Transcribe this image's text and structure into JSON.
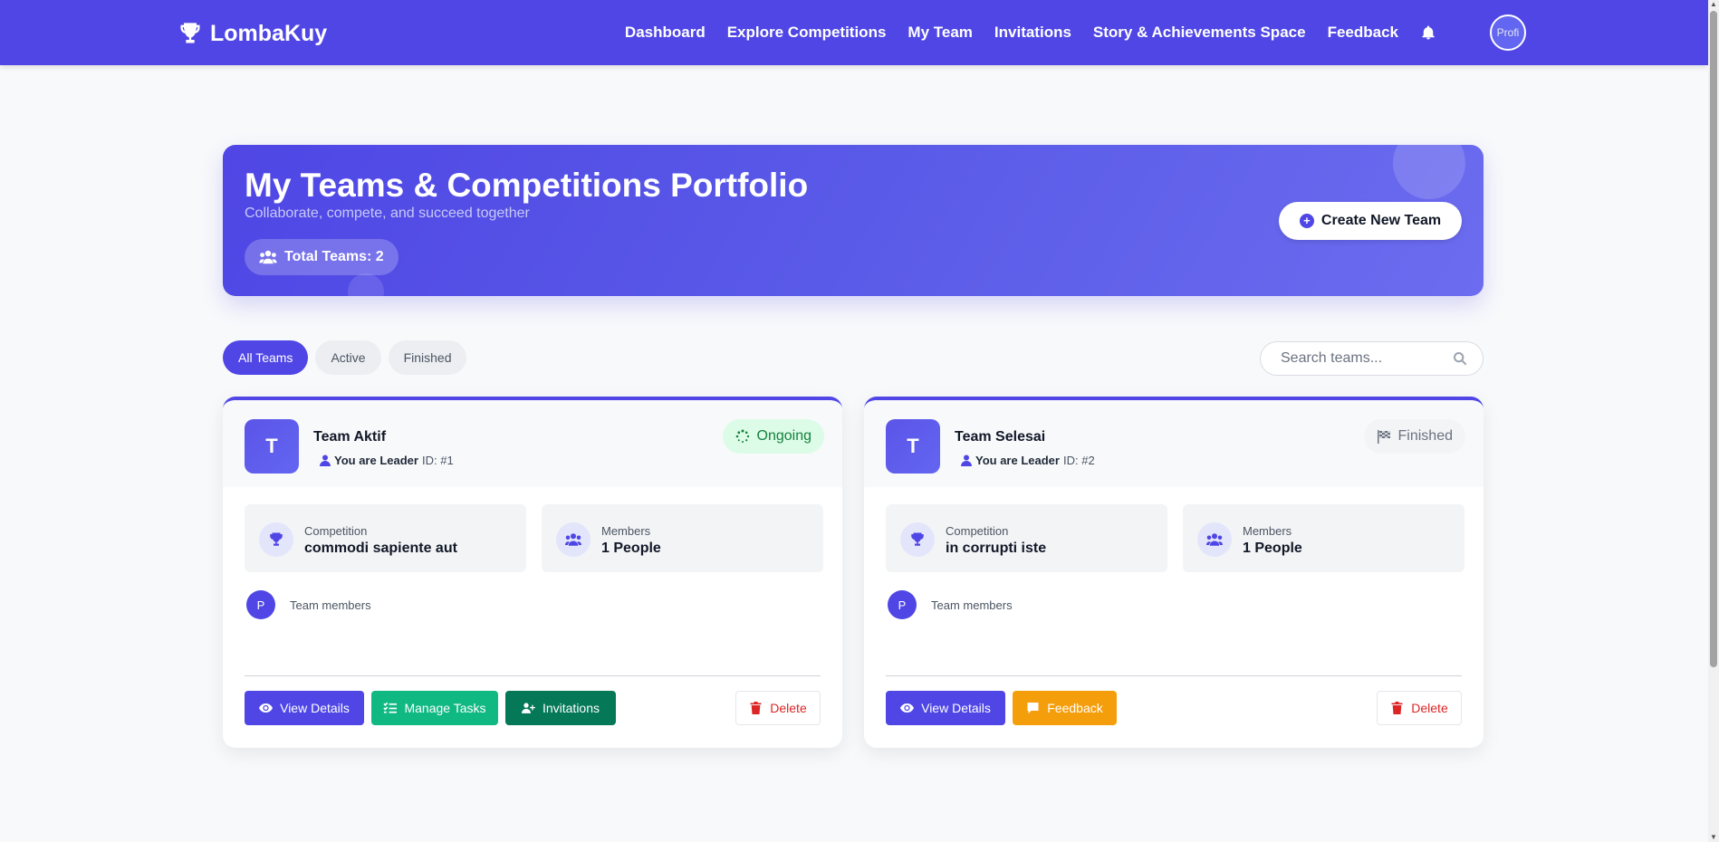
{
  "navbar": {
    "brand": "LombaKuy",
    "links": [
      "Dashboard",
      "Explore Competitions",
      "My Team",
      "Invitations",
      "Story & Achievements Space",
      "Feedback"
    ],
    "avatar_alt": "Profi"
  },
  "hero": {
    "title": "My Teams & Competitions Portfolio",
    "subtitle": "Collaborate, compete, and succeed together",
    "total_teams": "Total Teams: 2",
    "create_button": "Create New Team"
  },
  "filters": {
    "tabs": [
      "All Teams",
      "Active",
      "Finished"
    ],
    "active": "All Teams",
    "search_placeholder": "Search teams..."
  },
  "teams": [
    {
      "initial": "T",
      "name": "Team Aktif",
      "role": "You are Leader",
      "id": "ID: #1",
      "status": "Ongoing",
      "competition_label": "Competition",
      "competition": "commodi sapiente aut",
      "members_label": "Members",
      "members": "1 People",
      "member_initial": "P",
      "members_caption": "Team members",
      "buttons": [
        "View Details",
        "Manage Tasks",
        "Invitations"
      ],
      "delete": "Delete"
    },
    {
      "initial": "T",
      "name": "Team Selesai",
      "role": "You are Leader",
      "id": "ID: #2",
      "status": "Finished",
      "competition_label": "Competition",
      "competition": "in corrupti iste",
      "members_label": "Members",
      "members": "1 People",
      "member_initial": "P",
      "members_caption": "Team members",
      "buttons": [
        "View Details",
        "Feedback"
      ],
      "delete": "Delete"
    }
  ],
  "colors": {
    "primary": "#4f46e5",
    "success": "#10b981",
    "success_dark": "#047857",
    "warning": "#f59e0b",
    "danger": "#dc2626"
  }
}
